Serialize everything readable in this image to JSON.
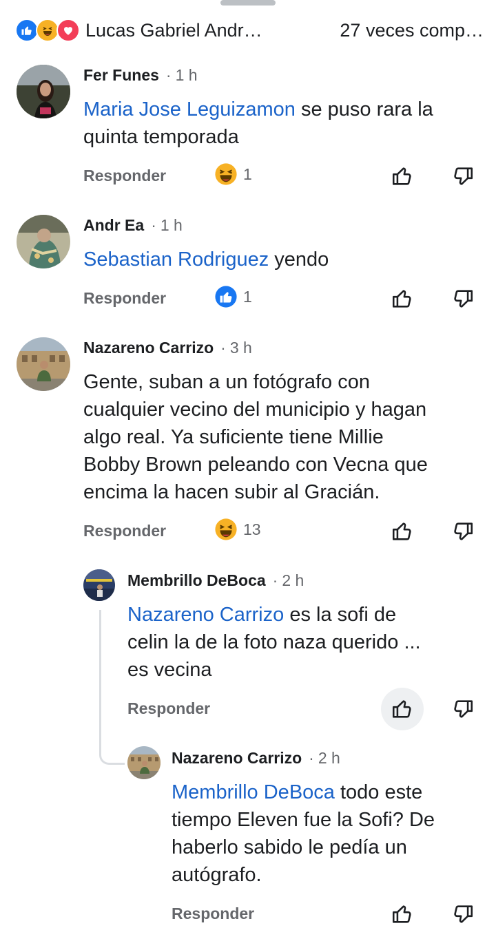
{
  "header": {
    "reaction_icons": [
      "like-icon",
      "haha-icon",
      "love-icon"
    ],
    "name": "Lucas Gabriel Andr…",
    "shares": "27 veces comp…"
  },
  "ui": {
    "reply_label": "Responder"
  },
  "comments": [
    {
      "author": "Fer Funes",
      "time": "1 h",
      "mention": "Maria Jose Leguizamon",
      "body_line1": " se puso rara la",
      "body_line2": "quinta temporada",
      "reaction_icon": "haha-icon",
      "reaction_count": "1"
    },
    {
      "author": "Andr Ea",
      "time": "1 h",
      "mention": "Sebastian Rodriguez",
      "body_line1": " yendo",
      "reaction_icon": "like-icon",
      "reaction_count": "1"
    },
    {
      "author": "Nazareno Carrizo",
      "time": "3 h",
      "body_lines": [
        "Gente, suban a un fotógrafo con",
        "cualquier vecino del municipio y hagan",
        "algo real. Ya suficiente tiene Millie",
        "Bobby Brown peleando con Vecna que",
        "encima la hacen subir al Gracián."
      ],
      "reaction_icon": "haha-icon",
      "reaction_count": "13"
    }
  ],
  "replies": [
    {
      "author": "Membrillo DeBoca",
      "time": "2 h",
      "mention": "Nazareno Carrizo",
      "body_line1": " es la sofi de",
      "body_line2": "celin la de la foto naza querido ...",
      "body_line3": "es vecina"
    },
    {
      "author": "Nazareno Carrizo",
      "time": "2 h",
      "mention": "Membrillo DeBoca",
      "body_line1": " todo este",
      "body_line2": "tiempo Eleven fue la Sofi? De",
      "body_line3": "haberlo sabido le pedía un",
      "body_line4": "autógrafo."
    }
  ],
  "colors": {
    "mention": "#1b63c9",
    "secondary_text": "#65676b",
    "like_blue": "#1877f2",
    "haha_yellow": "#f7b125",
    "love_red": "#f33e58"
  }
}
